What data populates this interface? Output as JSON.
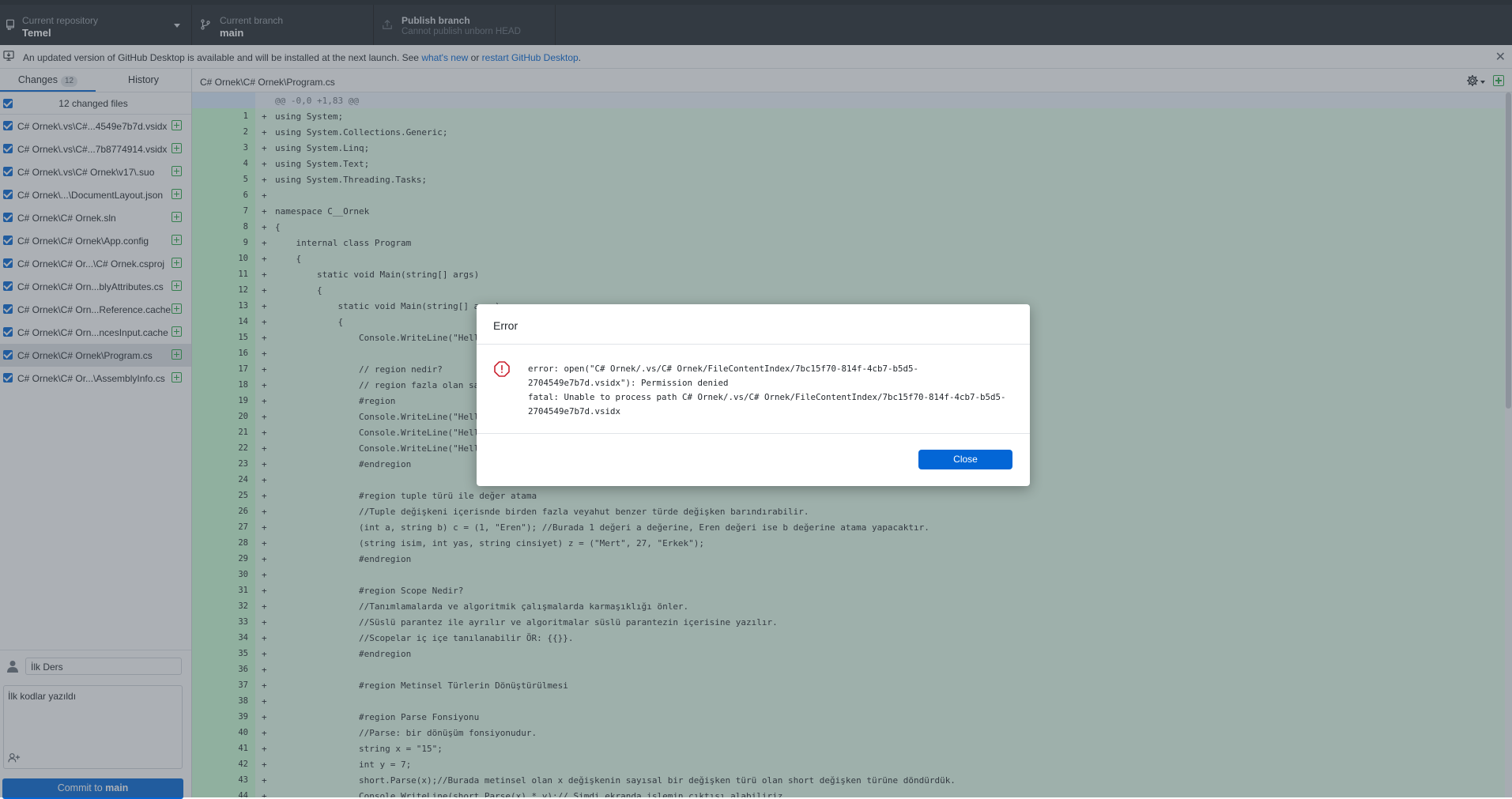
{
  "toolbar": {
    "repository": {
      "label": "Current repository",
      "value": "Temel"
    },
    "branch": {
      "label": "Current branch",
      "value": "main"
    },
    "publish": {
      "label": "Publish branch",
      "sub": "Cannot publish unborn HEAD"
    }
  },
  "banner": {
    "text_before": "An updated version of GitHub Desktop is available and will be installed at the next launch. See ",
    "link_whats_new": "what's new",
    "text_middle": " or ",
    "link_restart": "restart GitHub Desktop",
    "text_after": "."
  },
  "sidebar": {
    "tabs": [
      {
        "label": "Changes",
        "count": "12"
      },
      {
        "label": "History"
      }
    ],
    "changed_files_label": "12 changed files",
    "files": [
      "C# Ornek\\.vs\\C#...4549e7b7d.vsidx",
      "C# Ornek\\.vs\\C#...7b8774914.vsidx",
      "C# Ornek\\.vs\\C# Ornek\\v17\\.suo",
      "C# Ornek\\...\\DocumentLayout.json",
      "C# Ornek\\C# Ornek.sln",
      "C# Ornek\\C# Ornek\\App.config",
      "C# Ornek\\C# Or...\\C# Ornek.csproj",
      "C# Ornek\\C# Orn...blyAttributes.cs",
      "C# Ornek\\C# Orn...Reference.cache",
      "C# Ornek\\C# Orn...ncesInput.cache",
      "C# Ornek\\C# Ornek\\Program.cs",
      "C# Ornek\\C# Or...\\AssemblyInfo.cs"
    ],
    "selected_index": 10,
    "commit": {
      "summary": "İlk Ders",
      "description": "İlk kodlar yazıldı",
      "button_prefix": "Commit to ",
      "button_branch": "main"
    }
  },
  "diff": {
    "path": "C# Ornek\\C# Ornek\\Program.cs",
    "hunk": "@@ -0,0 +1,83 @@",
    "lines": [
      "using System;",
      "using System.Collections.Generic;",
      "using System.Linq;",
      "using System.Text;",
      "using System.Threading.Tasks;",
      "",
      "namespace C__Ornek",
      "{",
      "    internal class Program",
      "    {",
      "        static void Main(string[] args)",
      "        {",
      "            static void Main(string[] args)",
      "            {",
      "                Console.WriteLine(\"Hello W",
      "",
      "                // region nedir?",
      "                // region fazla olan satır",
      "                #region",
      "                Console.WriteLine(\"Hello W",
      "                Console.WriteLine(\"Hello W",
      "                Console.WriteLine(\"Hello W",
      "                #endregion",
      "",
      "                #region tuple türü ile değer atama",
      "                //Tuple değişkeni içerisnde birden fazla veyahut benzer türde değişken barındırabilir.",
      "                (int a, string b) c = (1, \"Eren\"); //Burada 1 değeri a değerine, Eren değeri ise b değerine atama yapacaktır.",
      "                (string isim, int yas, string cinsiyet) z = (\"Mert\", 27, \"Erkek\");",
      "                #endregion",
      "",
      "                #region Scope Nedir?",
      "                //Tanımlamalarda ve algoritmik çalışmalarda karmaşıklığı önler.",
      "                //Süslü parantez ile ayrılır ve algoritmalar süslü parantezin içerisine yazılır.",
      "                //Scopelar iç içe tanılanabilir ÖR: {{}}.",
      "                #endregion",
      "",
      "                #region Metinsel Türlerin Dönüştürülmesi",
      "",
      "                #region Parse Fonsiyonu",
      "                //Parse: bir dönüşüm fonsiyonudur.",
      "                string x = \"15\";",
      "                int y = 7;",
      "                short.Parse(x);//Burada metinsel olan x değişkenin sayısal bir değişken türü olan short değişken türüne döndürdük.",
      "                Console.WriteLine(short.Parse(x) * y);// Şimdi ekranda işlemin çıktısı alabiliriz."
    ]
  },
  "dialog": {
    "title": "Error",
    "message": "error: open(\"C# Ornek/.vs/C# Ornek/FileContentIndex/7bc15f70-814f-4cb7-b5d5-\n2704549e7b7d.vsidx\"): Permission denied\nfatal: Unable to process path C# Ornek/.vs/C# Ornek/FileContentIndex/7bc15f70-814f-4cb7-b5d5-\n2704549e7b7d.vsidx",
    "close_label": "Close"
  },
  "colors": {
    "accent": "#0366d6",
    "toolbar_bg": "#24292e",
    "added_line_bg": "#e6ffed",
    "added_gutter_bg": "#cdffd8",
    "error_icon": "#cb2431"
  },
  "icons": [
    "repo-icon",
    "branch-icon",
    "publish-icon",
    "desktop-update-icon",
    "close-icon",
    "gear-icon",
    "expand-icon",
    "person-icon",
    "add-coauthor-icon",
    "alert-icon"
  ]
}
